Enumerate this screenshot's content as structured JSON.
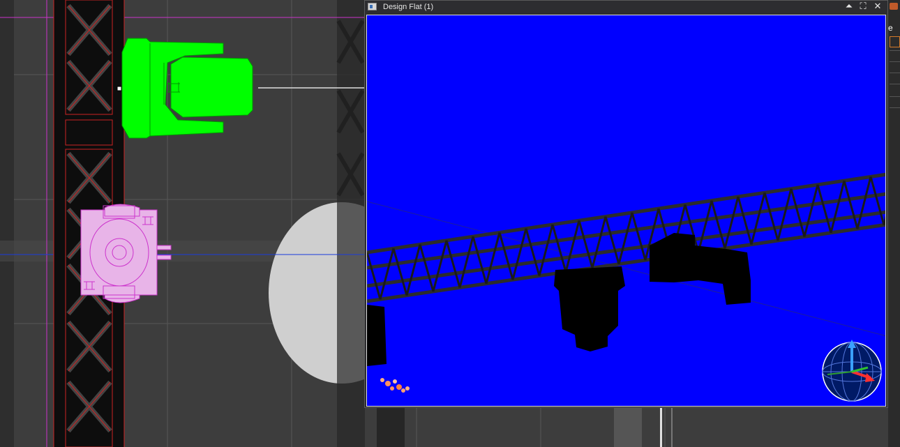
{
  "preview_window": {
    "title": "Design Flat (1)",
    "buttons": {
      "float": "⏶",
      "maximize": "⛶",
      "close": "✕"
    },
    "background_color": "#0000ff"
  },
  "right_panel": {
    "visible_letter": "e"
  },
  "colors": {
    "plan_background": "#3d3d3d",
    "grid_line": "#555555",
    "truss_outline": "#cc2222",
    "moving_head_fixture": "#00ff00",
    "wash_fixture": "#e8b4e8",
    "wash_fixture_outline": "#cc33cc",
    "guide_line_magenta": "#cc33cc",
    "guide_line_blue": "#1a3bdc",
    "preview_background": "#0000ff"
  },
  "icons": {
    "app_window_icon": "document-window-icon",
    "orientation_gizmo": "navigation-globe-icon"
  }
}
